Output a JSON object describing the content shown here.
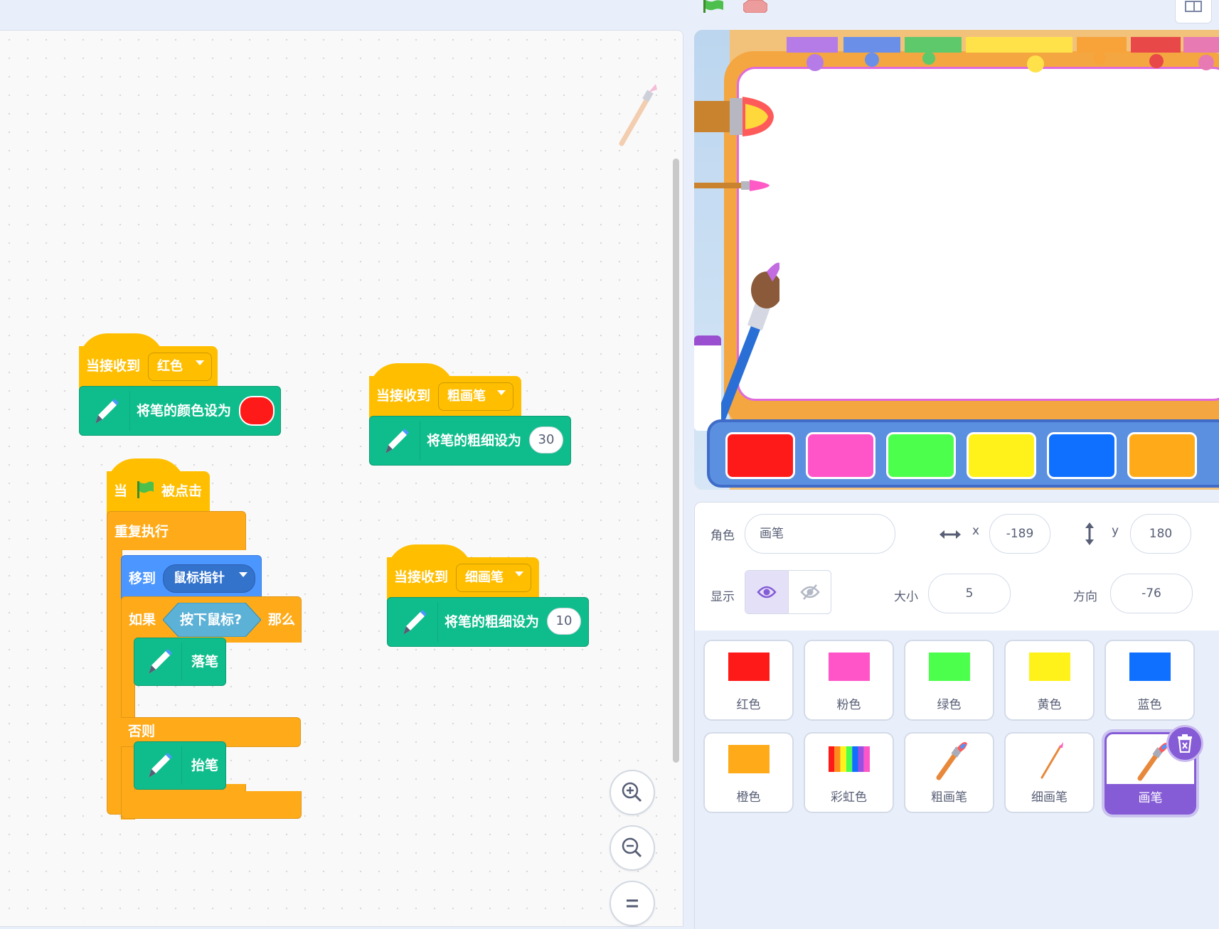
{
  "blocks": {
    "when_receive_red": {
      "hat": "当接收到",
      "msg": "红色",
      "action": "将笔的颜色设为",
      "color_value": "#ff1a1a"
    },
    "when_receive_thick": {
      "hat": "当接收到",
      "msg": "粗画笔",
      "action": "将笔的粗细设为",
      "value": "30"
    },
    "when_receive_thin": {
      "hat": "当接收到",
      "msg": "细画笔",
      "action": "将笔的粗细设为",
      "value": "10"
    },
    "flag_script": {
      "when": "当",
      "clicked": "被点击",
      "forever": "重复执行",
      "goto": "移到",
      "goto_target": "鼠标指针",
      "if": "如果",
      "condition": "按下鼠标?",
      "then": "那么",
      "pen_down": "落笔",
      "else": "否则",
      "pen_up": "抬笔"
    }
  },
  "stage_palette": [
    "#ff1a1a",
    "#ff55c8",
    "#4dff4d",
    "#fff21a",
    "#0f70ff",
    "#ffab19"
  ],
  "sprite_info": {
    "sprite_label": "角色",
    "sprite_name": "画笔",
    "x_label": "x",
    "x_value": "-189",
    "y_label": "y",
    "y_value": "180",
    "show_label": "显示",
    "size_label": "大小",
    "size_value": "5",
    "direction_label": "方向",
    "direction_value": "-76"
  },
  "sprites": [
    {
      "name": "红色",
      "color": "#ff1a1a"
    },
    {
      "name": "粉色",
      "color": "#ff55c8"
    },
    {
      "name": "绿色",
      "color": "#4dff4d"
    },
    {
      "name": "黄色",
      "color": "#fff21a"
    },
    {
      "name": "蓝色",
      "color": "#0f70ff"
    },
    {
      "name": "橙色",
      "color": "#ffab19"
    },
    {
      "name": "彩虹色",
      "color": "rainbow"
    },
    {
      "name": "粗画笔",
      "color": "brush"
    },
    {
      "name": "细画笔",
      "color": "thin-brush"
    },
    {
      "name": "画笔",
      "color": "brush",
      "selected": true
    }
  ],
  "colors": {
    "events": "#ffbf00",
    "pen": "#0fbd8c",
    "control": "#ffab19",
    "motion": "#4c97ff",
    "selected": "#855cd6"
  }
}
